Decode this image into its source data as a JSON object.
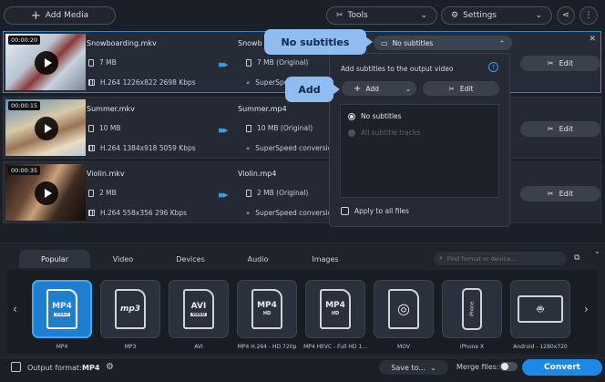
{
  "toolbar": {
    "add_media": "Add Media",
    "tools": "Tools",
    "settings": "Settings"
  },
  "files": [
    {
      "duration": "00:00:20",
      "name": "Snowboarding.mkv",
      "size": "7 MB",
      "codec": "H.264 1226x822 2698 Kbps",
      "out_name": "Snowb",
      "out_size": "7 MB (Original)",
      "superspeed": "SuperSpeed",
      "edit": "Edit"
    },
    {
      "duration": "00:00:15",
      "name": "Summer.mkv",
      "size": "10 MB",
      "codec": "H.264 1384x918 5059 Kbps",
      "out_name": "Summer.mp4",
      "out_size": "10 MB (Original)",
      "superspeed": "SuperSpeed conversio",
      "edit": "Edit"
    },
    {
      "duration": "00:00:35",
      "name": "Violin.mkv",
      "size": "2 MB",
      "codec": "H.264 558x356 296 Kbps",
      "out_name": "Violin.mp4",
      "out_size": "2 MB (Original)",
      "superspeed": "SuperSpeed conversio",
      "edit": "Edit"
    }
  ],
  "subtitles": {
    "dropdown_value": "No subtitles",
    "panel_title": "Add subtitles to the output video",
    "add_label": "Add",
    "edit_label": "Edit",
    "options": [
      "No subtitles",
      "All subtitle tracks"
    ],
    "apply_all": "Apply to all files"
  },
  "callouts": {
    "no_subtitles": "No subtitles",
    "add": "Add"
  },
  "tabs": [
    "Popular",
    "Video",
    "Devices",
    "Audio",
    "Images"
  ],
  "search": {
    "placeholder": "Find format or device..."
  },
  "formats": [
    {
      "label": "MP4",
      "icon": "MP4"
    },
    {
      "label": "MP3",
      "icon": "mp3"
    },
    {
      "label": "AVI",
      "icon": "AVI"
    },
    {
      "label": "MP4 H.264 - HD 720p",
      "icon": "MP4"
    },
    {
      "label": "MP4 HEVC - Full HD 1...",
      "icon": "MP4"
    },
    {
      "label": "MOV",
      "icon": "MOV"
    },
    {
      "label": "iPhone X",
      "icon": "iPhone"
    },
    {
      "label": "Android - 1280x720",
      "icon": "Android"
    }
  ],
  "footer": {
    "output_format_label": "Output format:",
    "output_format_value": "MP4",
    "save_to": "Save to...",
    "merge_files": "Merge files:",
    "convert": "Convert"
  },
  "colors": {
    "accent": "#1e88e5",
    "callout": "#8fbdf1"
  }
}
